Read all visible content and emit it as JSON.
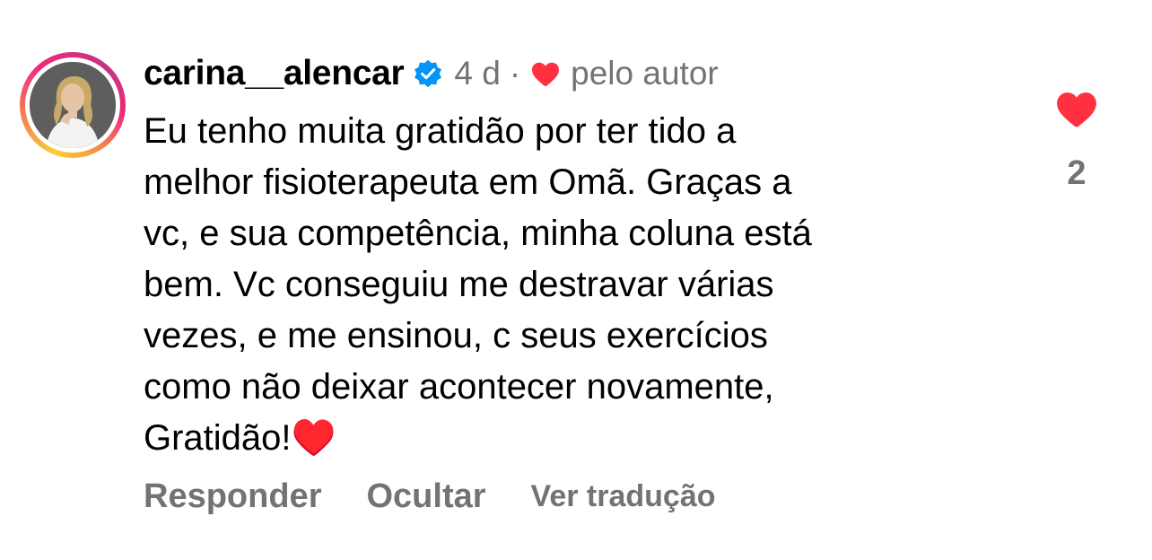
{
  "comment": {
    "username": "carina__alencar",
    "timestamp": "4 d",
    "separator": "·",
    "liked_by_author_label": "pelo autor",
    "text": "Eu tenho muita gratidão por ter tido a\nmelhor fisioterapeuta em Omã. Graças a\nvc, e sua competência, minha coluna está\nbem. Vc conseguiu me destravar várias\nvezes, e me ensinou, c seus exercícios\ncomo não deixar acontecer novamente,\nGratidão!♥️",
    "like_count": "2",
    "actions": {
      "reply": "Responder",
      "hide": "Ocultar",
      "translate": "Ver tradução"
    }
  },
  "icons": {
    "verified": "verified-badge-icon",
    "author_heart": "heart-icon",
    "like": "heart-icon"
  },
  "colors": {
    "verified_blue": "#0095f6",
    "heart_red": "#ff3040",
    "secondary_text": "#737373"
  }
}
